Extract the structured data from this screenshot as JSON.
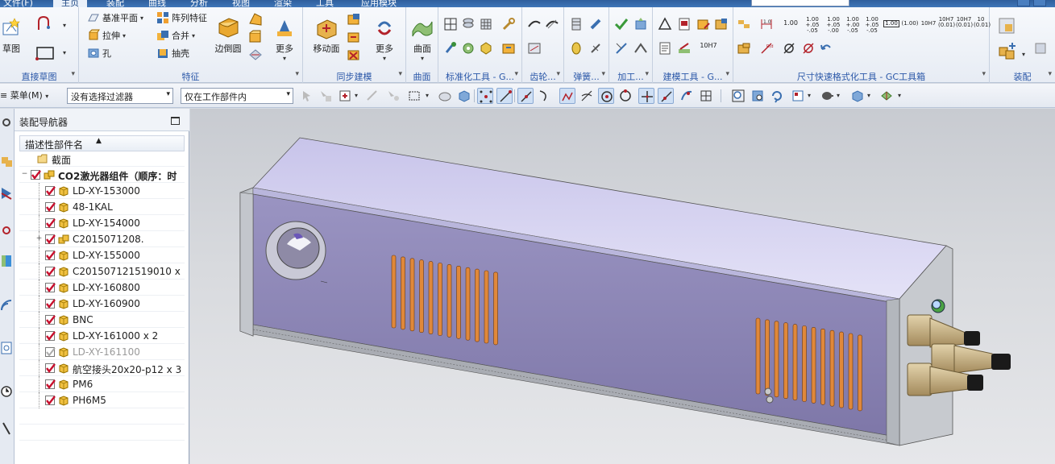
{
  "ribbon_tabs": [
    "主页",
    "装配",
    "曲线",
    "分析",
    "视图",
    "渲染",
    "工具",
    "应用模块"
  ],
  "groups": {
    "direct_sketch": {
      "label": "直接草图",
      "sketch_label": "草图"
    },
    "feature": {
      "label": "特征",
      "datum_plane": "基准平面",
      "pattern_feature": "阵列特征",
      "extrude": "拉伸",
      "unite": "合并",
      "hole": "孔",
      "shell": "抽壳",
      "edge_blend": "边倒圆",
      "more": "更多"
    },
    "sync_modeling": {
      "label": "同步建模",
      "move_face": "移动面",
      "more": "更多"
    },
    "surface": {
      "label": "曲面",
      "surface_btn": "曲面"
    },
    "std_tools": {
      "label": "标准化工具 - G..."
    },
    "gear": {
      "label": "齿轮..."
    },
    "spring": {
      "label": "弹簧..."
    },
    "machining": {
      "label": "加工..."
    },
    "modeling_tools": {
      "label": "建模工具 - G..."
    },
    "dimension_format": {
      "label": "尺寸快速格式化工具 - GC工具箱",
      "tolerances": [
        {
          "base": "1.00",
          "upper": "",
          "lower": ""
        },
        {
          "base": "1.00",
          "upper": "+.05",
          "lower": "-.05"
        },
        {
          "base": "1.00",
          "upper": "+.05",
          "lower": "-.00"
        },
        {
          "base": "1.00",
          "upper": "+.00",
          "lower": "-.05"
        },
        {
          "base": "1.00",
          "upper": "+.05",
          "lower": "-.05"
        }
      ],
      "boxed_value": "1.00",
      "paren_value": "(1.00)",
      "fit_labels": [
        "10H7",
        "10H7",
        "10H7",
        "10"
      ],
      "fit_sub": [
        "",
        "(0.01)",
        "(0.01)",
        "(0.01)"
      ],
      "diam_label": "10H7"
    },
    "assembly": {
      "label": "装配"
    }
  },
  "toolbar": {
    "menu_label": "菜单(M)",
    "filter_value": "没有选择过滤器",
    "scope_value": "仅在工作部件内"
  },
  "navigator": {
    "title": "装配导航器",
    "column_header": "描述性部件名",
    "items": [
      {
        "label": "截面",
        "type": "folder",
        "indent": 1,
        "check": false,
        "expand": ""
      },
      {
        "label": "CO2激光器组件（顺序：时",
        "type": "assembly",
        "indent": 0,
        "check": true,
        "expand": "−",
        "bold": true
      },
      {
        "label": "LD-XY-153000",
        "type": "part",
        "indent": 2,
        "check": true,
        "expand": ""
      },
      {
        "label": "48-1KAL",
        "type": "part",
        "indent": 2,
        "check": true,
        "expand": ""
      },
      {
        "label": "LD-XY-154000",
        "type": "part",
        "indent": 2,
        "check": true,
        "expand": ""
      },
      {
        "label": "C2015071208.",
        "type": "assembly",
        "indent": 2,
        "check": true,
        "expand": "+"
      },
      {
        "label": "LD-XY-155000",
        "type": "part",
        "indent": 2,
        "check": true,
        "expand": ""
      },
      {
        "label": "C201507121519010 x",
        "type": "part",
        "indent": 2,
        "check": true,
        "expand": ""
      },
      {
        "label": "LD-XY-160800",
        "type": "part",
        "indent": 2,
        "check": true,
        "expand": ""
      },
      {
        "label": "LD-XY-160900",
        "type": "part",
        "indent": 2,
        "check": true,
        "expand": ""
      },
      {
        "label": "BNC",
        "type": "part",
        "indent": 2,
        "check": true,
        "expand": ""
      },
      {
        "label": "LD-XY-161000 x 2",
        "type": "part",
        "indent": 2,
        "check": true,
        "expand": ""
      },
      {
        "label": "LD-XY-161100",
        "type": "part",
        "indent": 2,
        "check": false,
        "grey": true,
        "expand": ""
      },
      {
        "label": "航空接头20x20-p12 x 3",
        "type": "part",
        "indent": 2,
        "check": true,
        "expand": ""
      },
      {
        "label": "PM6",
        "type": "part",
        "indent": 2,
        "check": true,
        "expand": ""
      },
      {
        "label": "PH6M5",
        "type": "part",
        "indent": 2,
        "check": true,
        "expand": ""
      }
    ]
  },
  "colors": {
    "ribbon_label": "#2a57a8",
    "model_top": "#d9d8f4",
    "model_front": "#8f88b8",
    "vent_orange": "#e0883a",
    "connector_tan": "#cbb68a",
    "viewport_bg": "#d8dade"
  }
}
